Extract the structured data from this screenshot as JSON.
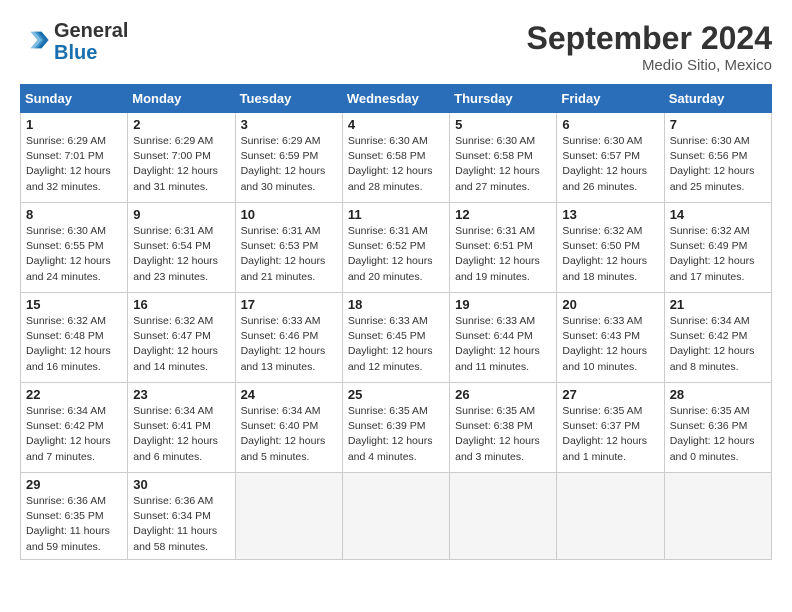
{
  "logo": {
    "line1": "General",
    "line2": "Blue"
  },
  "title": "September 2024",
  "subtitle": "Medio Sitio, Mexico",
  "weekdays": [
    "Sunday",
    "Monday",
    "Tuesday",
    "Wednesday",
    "Thursday",
    "Friday",
    "Saturday"
  ],
  "weeks": [
    [
      {
        "day": "1",
        "info": "Sunrise: 6:29 AM\nSunset: 7:01 PM\nDaylight: 12 hours\nand 32 minutes."
      },
      {
        "day": "2",
        "info": "Sunrise: 6:29 AM\nSunset: 7:00 PM\nDaylight: 12 hours\nand 31 minutes."
      },
      {
        "day": "3",
        "info": "Sunrise: 6:29 AM\nSunset: 6:59 PM\nDaylight: 12 hours\nand 30 minutes."
      },
      {
        "day": "4",
        "info": "Sunrise: 6:30 AM\nSunset: 6:58 PM\nDaylight: 12 hours\nand 28 minutes."
      },
      {
        "day": "5",
        "info": "Sunrise: 6:30 AM\nSunset: 6:58 PM\nDaylight: 12 hours\nand 27 minutes."
      },
      {
        "day": "6",
        "info": "Sunrise: 6:30 AM\nSunset: 6:57 PM\nDaylight: 12 hours\nand 26 minutes."
      },
      {
        "day": "7",
        "info": "Sunrise: 6:30 AM\nSunset: 6:56 PM\nDaylight: 12 hours\nand 25 minutes."
      }
    ],
    [
      {
        "day": "8",
        "info": "Sunrise: 6:30 AM\nSunset: 6:55 PM\nDaylight: 12 hours\nand 24 minutes."
      },
      {
        "day": "9",
        "info": "Sunrise: 6:31 AM\nSunset: 6:54 PM\nDaylight: 12 hours\nand 23 minutes."
      },
      {
        "day": "10",
        "info": "Sunrise: 6:31 AM\nSunset: 6:53 PM\nDaylight: 12 hours\nand 21 minutes."
      },
      {
        "day": "11",
        "info": "Sunrise: 6:31 AM\nSunset: 6:52 PM\nDaylight: 12 hours\nand 20 minutes."
      },
      {
        "day": "12",
        "info": "Sunrise: 6:31 AM\nSunset: 6:51 PM\nDaylight: 12 hours\nand 19 minutes."
      },
      {
        "day": "13",
        "info": "Sunrise: 6:32 AM\nSunset: 6:50 PM\nDaylight: 12 hours\nand 18 minutes."
      },
      {
        "day": "14",
        "info": "Sunrise: 6:32 AM\nSunset: 6:49 PM\nDaylight: 12 hours\nand 17 minutes."
      }
    ],
    [
      {
        "day": "15",
        "info": "Sunrise: 6:32 AM\nSunset: 6:48 PM\nDaylight: 12 hours\nand 16 minutes."
      },
      {
        "day": "16",
        "info": "Sunrise: 6:32 AM\nSunset: 6:47 PM\nDaylight: 12 hours\nand 14 minutes."
      },
      {
        "day": "17",
        "info": "Sunrise: 6:33 AM\nSunset: 6:46 PM\nDaylight: 12 hours\nand 13 minutes."
      },
      {
        "day": "18",
        "info": "Sunrise: 6:33 AM\nSunset: 6:45 PM\nDaylight: 12 hours\nand 12 minutes."
      },
      {
        "day": "19",
        "info": "Sunrise: 6:33 AM\nSunset: 6:44 PM\nDaylight: 12 hours\nand 11 minutes."
      },
      {
        "day": "20",
        "info": "Sunrise: 6:33 AM\nSunset: 6:43 PM\nDaylight: 12 hours\nand 10 minutes."
      },
      {
        "day": "21",
        "info": "Sunrise: 6:34 AM\nSunset: 6:42 PM\nDaylight: 12 hours\nand 8 minutes."
      }
    ],
    [
      {
        "day": "22",
        "info": "Sunrise: 6:34 AM\nSunset: 6:42 PM\nDaylight: 12 hours\nand 7 minutes."
      },
      {
        "day": "23",
        "info": "Sunrise: 6:34 AM\nSunset: 6:41 PM\nDaylight: 12 hours\nand 6 minutes."
      },
      {
        "day": "24",
        "info": "Sunrise: 6:34 AM\nSunset: 6:40 PM\nDaylight: 12 hours\nand 5 minutes."
      },
      {
        "day": "25",
        "info": "Sunrise: 6:35 AM\nSunset: 6:39 PM\nDaylight: 12 hours\nand 4 minutes."
      },
      {
        "day": "26",
        "info": "Sunrise: 6:35 AM\nSunset: 6:38 PM\nDaylight: 12 hours\nand 3 minutes."
      },
      {
        "day": "27",
        "info": "Sunrise: 6:35 AM\nSunset: 6:37 PM\nDaylight: 12 hours\nand 1 minute."
      },
      {
        "day": "28",
        "info": "Sunrise: 6:35 AM\nSunset: 6:36 PM\nDaylight: 12 hours\nand 0 minutes."
      }
    ],
    [
      {
        "day": "29",
        "info": "Sunrise: 6:36 AM\nSunset: 6:35 PM\nDaylight: 11 hours\nand 59 minutes."
      },
      {
        "day": "30",
        "info": "Sunrise: 6:36 AM\nSunset: 6:34 PM\nDaylight: 11 hours\nand 58 minutes."
      },
      null,
      null,
      null,
      null,
      null
    ]
  ]
}
